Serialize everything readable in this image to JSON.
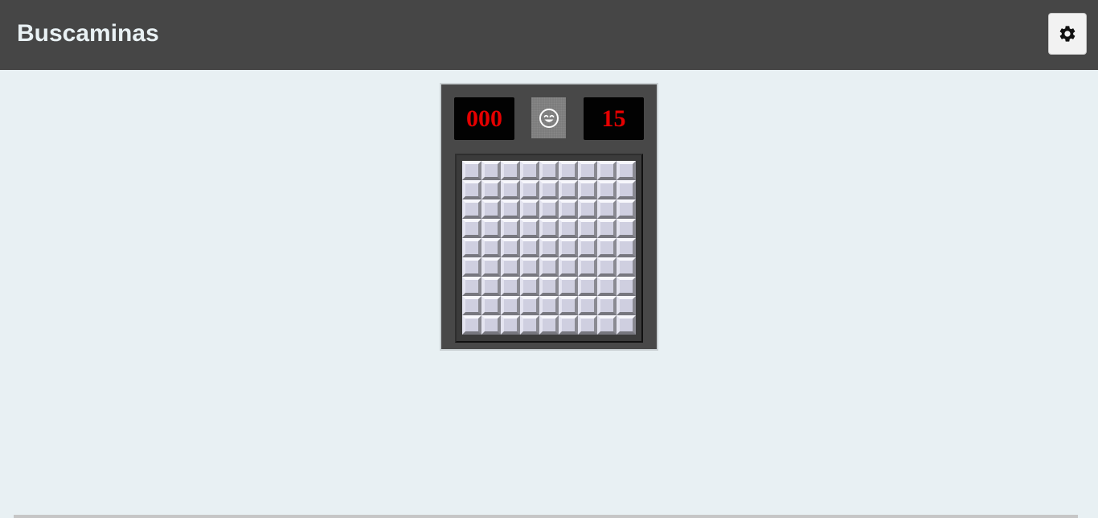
{
  "app": {
    "title": "Buscaminas"
  },
  "header": {
    "settings_icon": "gear-icon"
  },
  "game": {
    "timer": "000",
    "mines_remaining": "15",
    "face_icon": "smiling-face-icon",
    "rows": 9,
    "cols": 9,
    "cell_state": "covered"
  },
  "colors": {
    "header_bg": "#464646",
    "page_bg": "#e8f0f3",
    "panel_bg": "#484848",
    "counter_bg": "#020202",
    "counter_digits": "#e50000",
    "cell_face": "#cfcfe0"
  }
}
